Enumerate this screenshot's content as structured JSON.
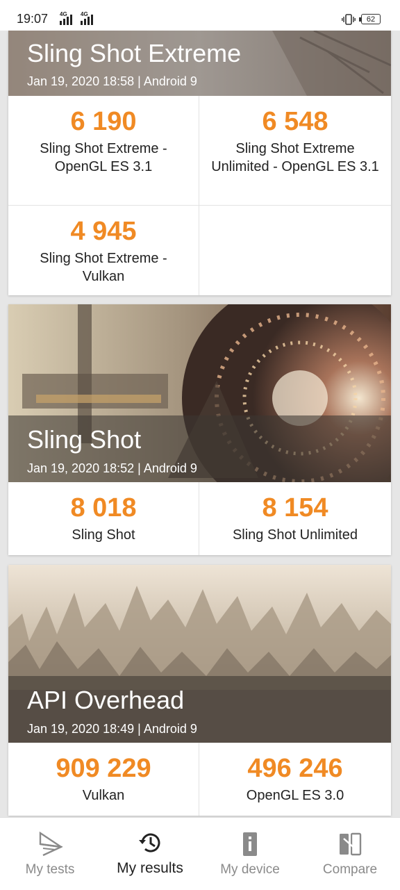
{
  "status_bar": {
    "time": "19:07",
    "network_1": "4G",
    "network_2": "4G",
    "battery": "62",
    "icons": [
      "signal-icon",
      "signal-icon",
      "vibrate-icon",
      "battery-icon"
    ]
  },
  "cards": [
    {
      "title": "Sling Shot Extreme",
      "subtitle": "Jan 19, 2020 18:58 | Android 9",
      "results": [
        {
          "score": "6 190",
          "label": "Sling Shot Extreme - OpenGL ES 3.1"
        },
        {
          "score": "6 548",
          "label": "Sling Shot Extreme Unlimited - OpenGL ES 3.1"
        },
        {
          "score": "4 945",
          "label": "Sling Shot Extreme - Vulkan"
        }
      ]
    },
    {
      "title": "Sling Shot",
      "subtitle": "Jan 19, 2020 18:52 | Android 9",
      "results": [
        {
          "score": "8 018",
          "label": "Sling Shot"
        },
        {
          "score": "8 154",
          "label": "Sling Shot Unlimited"
        }
      ]
    },
    {
      "title": "API Overhead",
      "subtitle": "Jan 19, 2020 18:49 | Android 9",
      "results": [
        {
          "score": "909 229",
          "label": "Vulkan"
        },
        {
          "score": "496 246",
          "label": "OpenGL ES 3.0"
        }
      ]
    }
  ],
  "nav": {
    "items": [
      {
        "label": "My tests",
        "icon": "3dmark-logo-icon",
        "active": false
      },
      {
        "label": "My results",
        "icon": "history-icon",
        "active": true
      },
      {
        "label": "My device",
        "icon": "device-info-icon",
        "active": false
      },
      {
        "label": "Compare",
        "icon": "compare-icon",
        "active": false
      }
    ]
  },
  "colors": {
    "score": "#f08a24",
    "active_nav": "#222222",
    "inactive_nav": "#8a8a8a"
  }
}
